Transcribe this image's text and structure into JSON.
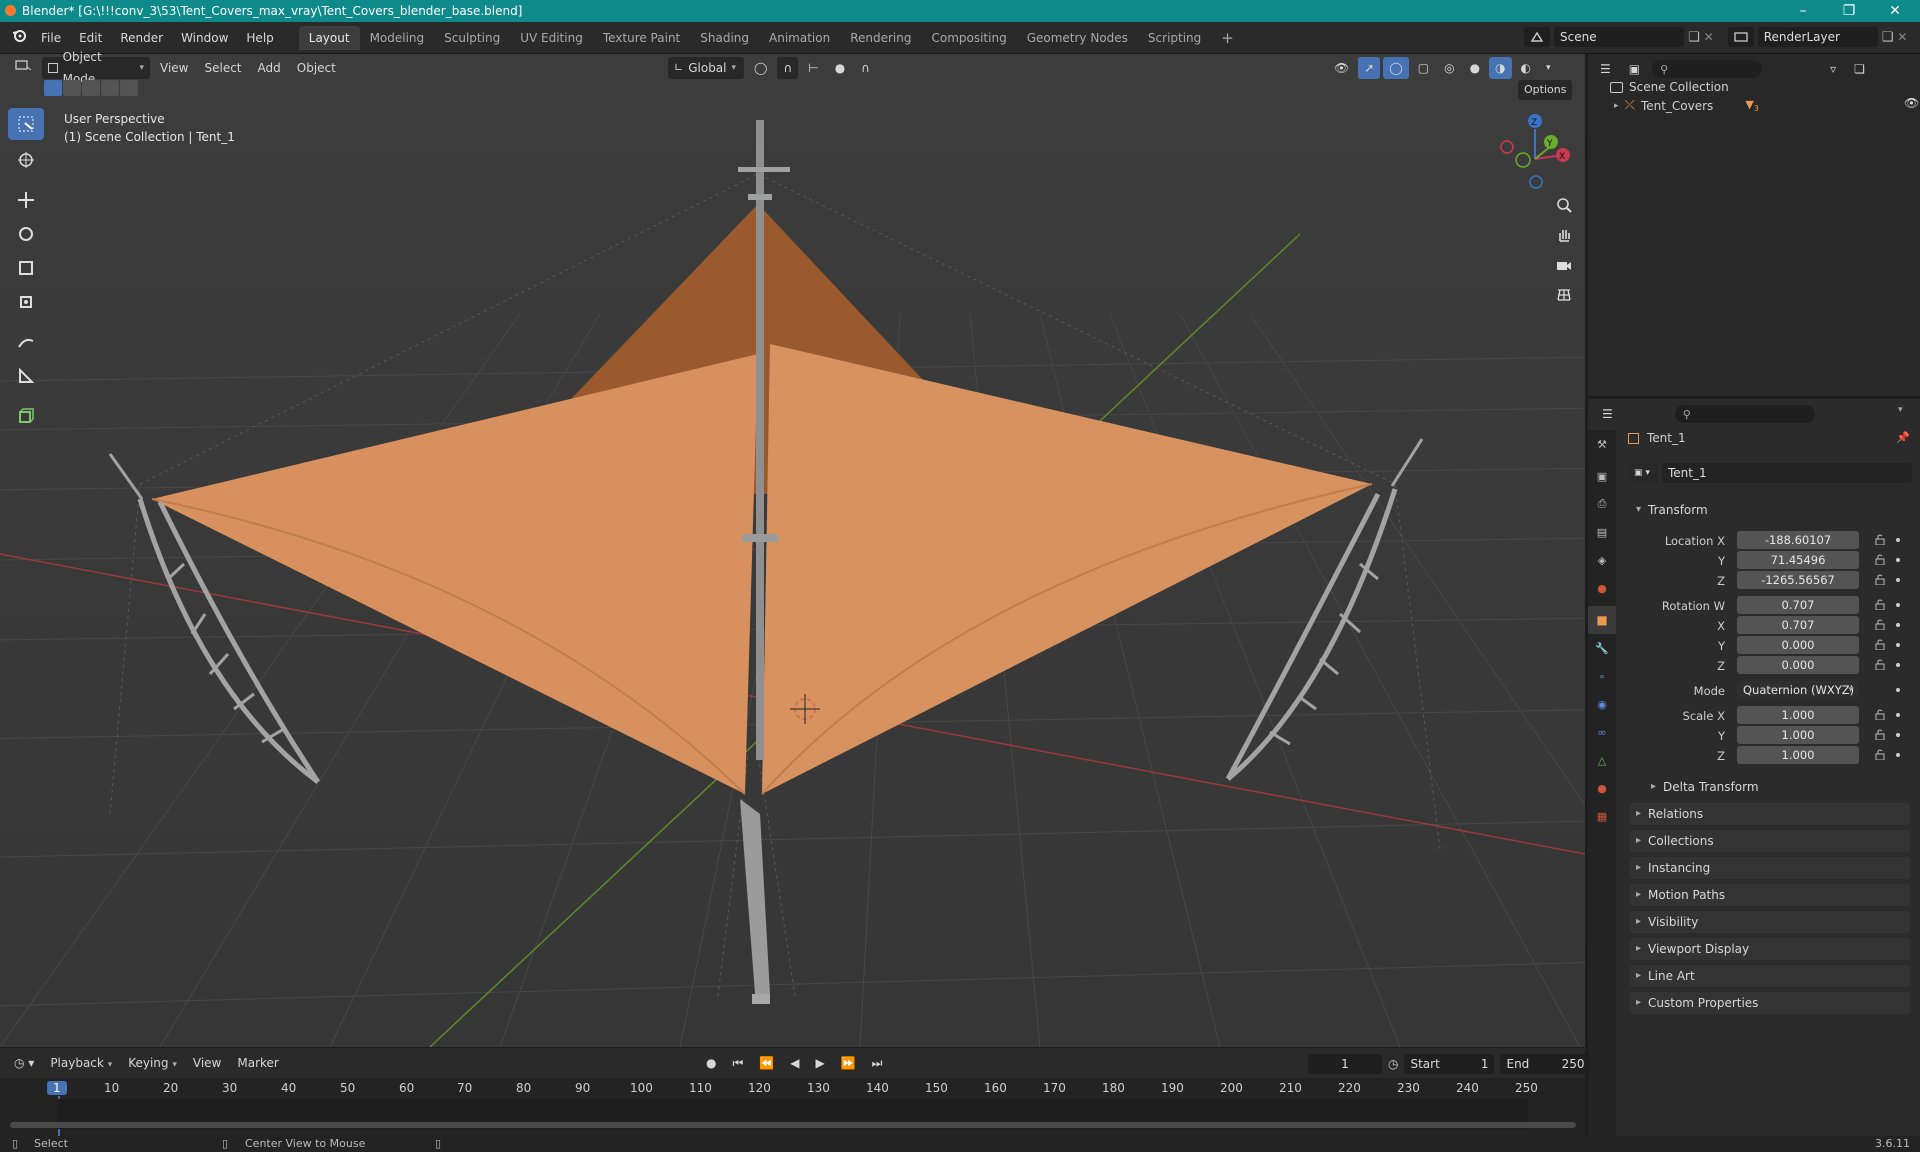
{
  "window": {
    "title": "Blender* [G:\\!!!conv_3\\53\\Tent_Covers_max_vray\\Tent_Covers_blender_base.blend]"
  },
  "menu": [
    "File",
    "Edit",
    "Render",
    "Window",
    "Help"
  ],
  "workspaces": [
    "Layout",
    "Modeling",
    "Sculpting",
    "UV Editing",
    "Texture Paint",
    "Shading",
    "Animation",
    "Rendering",
    "Compositing",
    "Geometry Nodes",
    "Scripting"
  ],
  "active_workspace": "Layout",
  "scene": {
    "name": "Scene",
    "view_layer": "RenderLayer"
  },
  "viewport_header": {
    "mode": "Object Mode",
    "menus": [
      "View",
      "Select",
      "Add",
      "Object"
    ],
    "orientation": "Global",
    "options": "Options"
  },
  "viewport": {
    "perspective": "User Perspective",
    "collection": "(1) Scene Collection | Tent_1",
    "gizmo_axes": {
      "x": "X",
      "y": "Y",
      "z": "Z"
    },
    "colors": {
      "background": "#393939",
      "grid": "#4a4a4a",
      "x_axis": "#9c3a3a",
      "y_axis": "#5d8a2a",
      "tent": "#d8915e",
      "tent_dark": "#9a5a2e",
      "pole": "#9b9b9b"
    }
  },
  "outliner": {
    "root": "Scene Collection",
    "items": [
      {
        "name": "Tent_Covers",
        "badge": "3"
      }
    ]
  },
  "properties": {
    "object_name": "Tent_1",
    "datablock": "Tent_1",
    "transform": {
      "header": "Transform",
      "location": {
        "label_x": "Location X",
        "label_y": "Y",
        "label_z": "Z",
        "x": "-188.60107",
        "y": "71.45496",
        "z": "-1265.56567"
      },
      "rotation": {
        "label_w": "Rotation W",
        "label_x": "X",
        "label_y": "Y",
        "label_z": "Z",
        "w": "0.707",
        "x": "0.707",
        "y": "0.000",
        "z": "0.000"
      },
      "mode_label": "Mode",
      "mode": "Quaternion (WXYZ)",
      "scale": {
        "label_x": "Scale X",
        "label_y": "Y",
        "label_z": "Z",
        "x": "1.000",
        "y": "1.000",
        "z": "1.000"
      },
      "delta": "Delta Transform"
    },
    "panels": [
      "Relations",
      "Collections",
      "Instancing",
      "Motion Paths",
      "Visibility",
      "Viewport Display",
      "Line Art",
      "Custom Properties"
    ]
  },
  "timeline": {
    "menus": [
      "Playback",
      "Keying",
      "View",
      "Marker"
    ],
    "current_frame": "1",
    "start_label": "Start",
    "start": "1",
    "end_label": "End",
    "end": "250",
    "ticks": [
      "1",
      "10",
      "20",
      "30",
      "40",
      "50",
      "60",
      "70",
      "80",
      "90",
      "100",
      "110",
      "120",
      "130",
      "140",
      "150",
      "160",
      "170",
      "180",
      "190",
      "200",
      "210",
      "220",
      "230",
      "240",
      "250"
    ]
  },
  "statusbar": {
    "select": "Select",
    "center": "Center View to Mouse",
    "version": "3.6.11"
  }
}
